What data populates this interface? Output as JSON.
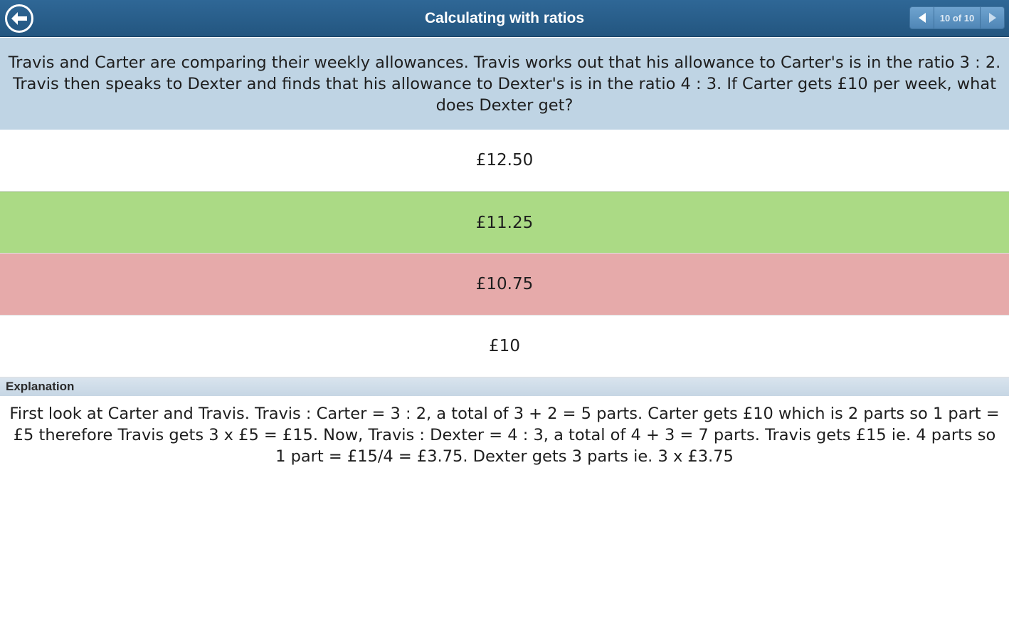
{
  "header": {
    "title": "Calculating with ratios",
    "back_icon": "back-arrow-icon",
    "pager": {
      "text": "10 of 10",
      "prev_icon": "triangle-left-icon",
      "next_icon": "triangle-right-icon"
    },
    "colors": {
      "bar": "#2a5f8c"
    }
  },
  "question": {
    "text": "Travis and Carter are comparing their weekly allowances. Travis works out that his allowance to Carter's is in the ratio 3 : 2. Travis then speaks to Dexter and finds that his allowance to Dexter's is in the ratio 4 : 3. If Carter gets £10 per week, what does Dexter get?"
  },
  "options": [
    {
      "label": "£12.50",
      "state": "neutral"
    },
    {
      "label": "£11.25",
      "state": "correct",
      "color": "#abda85"
    },
    {
      "label": "£10.75",
      "state": "incorrect",
      "color": "#e6aaaa"
    },
    {
      "label": "£10",
      "state": "neutral"
    }
  ],
  "explanation": {
    "heading": "Explanation",
    "text": "First look at Carter and Travis. Travis : Carter = 3 : 2, a total of 3 + 2 = 5 parts. Carter gets £10 which is 2 parts so 1 part = £5 therefore Travis gets 3 x £5 = £15. Now, Travis : Dexter = 4 : 3, a total of 4 + 3 = 7 parts. Travis gets £15 ie. 4 parts so 1 part = £15/4 = £3.75. Dexter gets 3 parts ie. 3 x £3.75"
  }
}
